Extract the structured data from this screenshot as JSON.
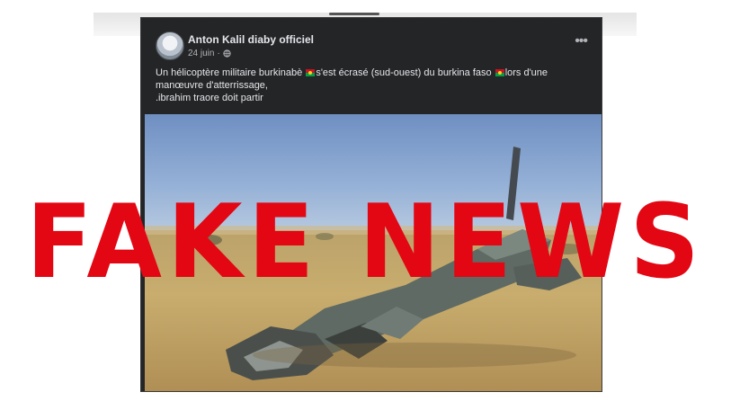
{
  "post": {
    "author": "Anton Kalil diaby officiel",
    "date": "24 juin",
    "dot": "·",
    "line1a": "Un hélicoptère militaire burkinabè ",
    "line1b": "s'est écrasé  (sud-ouest) du burkina faso ",
    "line1c": "lors d'une",
    "line2": "manœuvre d'atterrissage,",
    "line3": ".ibrahim traore doit partir",
    "more": "•••"
  },
  "overlay": {
    "stamp_text": "FAKE NEWS",
    "stamp_color": "#e30613"
  },
  "icons": {
    "privacy": "globe-icon",
    "flag": "burkina-faso-flag-icon",
    "menu": "more-options-icon"
  },
  "colors": {
    "card_bg": "#242526",
    "text": "#e4e6eb",
    "secondary_text": "#b0b3b8"
  }
}
